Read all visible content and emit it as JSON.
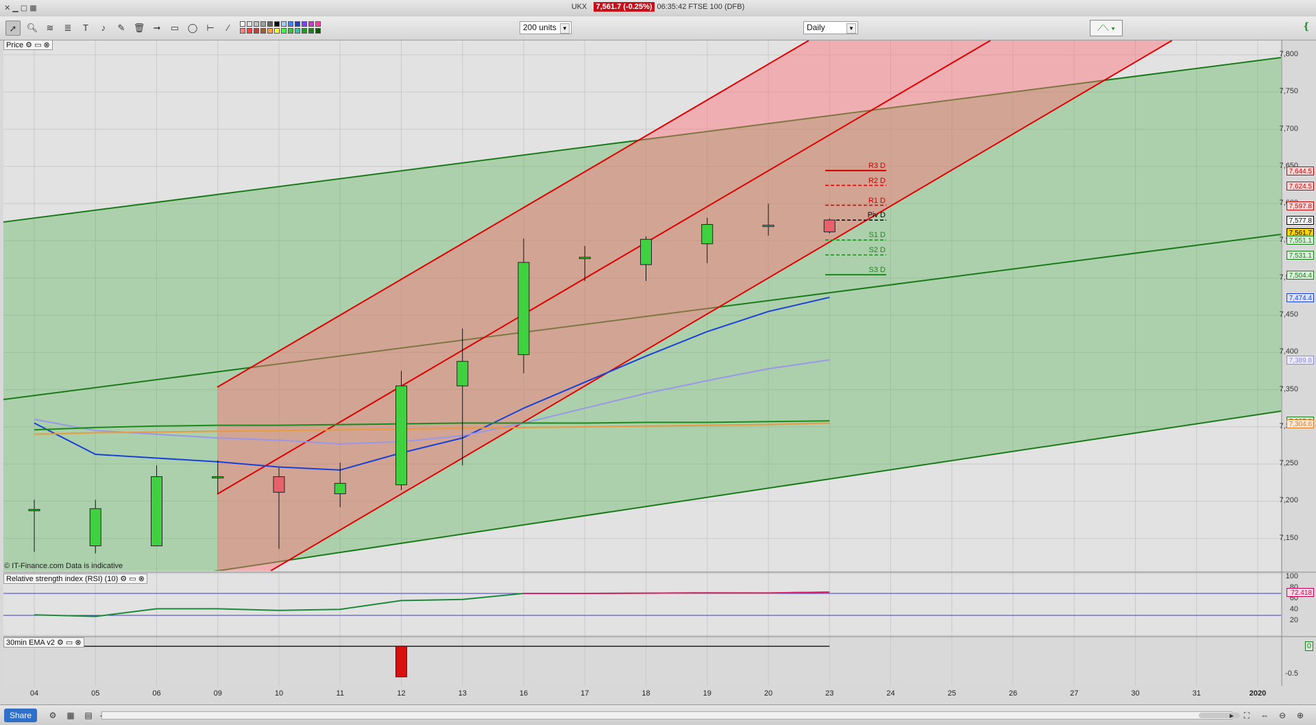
{
  "window": {
    "symbol": "UKX",
    "price_badge": "7,561.7 (-0.25%)",
    "status_line": "06:35:42 FTSE 100 (DFB)"
  },
  "toolbar": {
    "units_select": "200 units",
    "interval_select": "Daily"
  },
  "panels": {
    "price_label": "Price",
    "rsi_label": "Relative strength index (RSI) (10)",
    "ema_label": "30min EMA v2",
    "copyright": "© IT-Finance.com  Data is indicative"
  },
  "price_axis": {
    "ticks": [
      "7,800",
      "7,750",
      "7,700",
      "7,650",
      "7,600",
      "7,550",
      "7,500",
      "7,450",
      "7,400",
      "7,350",
      "7,300",
      "7,250",
      "7,200",
      "7,150"
    ],
    "tags": [
      {
        "text": "7,644.5",
        "color": "#cc0000",
        "bg": "#ffd9d9"
      },
      {
        "text": "7,624.5",
        "color": "#cc0000",
        "bg": "#ffd9d9"
      },
      {
        "text": "7,597.8",
        "color": "#cc0000",
        "bg": "#ffd9d9"
      },
      {
        "text": "7,577.8",
        "color": "#000000",
        "bg": "#ffffff"
      },
      {
        "text": "7,561.7",
        "color": "#000000",
        "bg": "#ffd400"
      },
      {
        "text": "7,551.1",
        "color": "#1a7a1a",
        "bg": "#d9f2d9"
      },
      {
        "text": "7,531.1",
        "color": "#1a7a1a",
        "bg": "#d9f2d9"
      },
      {
        "text": "7,504.4",
        "color": "#1a7a1a",
        "bg": "#d9f2d9"
      },
      {
        "text": "7,474.4",
        "color": "#1a3fd6",
        "bg": "#dde4ff"
      },
      {
        "text": "7,389.8",
        "color": "#8a86e0",
        "bg": "#ecebff"
      },
      {
        "text": "7,307.8",
        "color": "#1a7a1a",
        "bg": "#d9f2d9"
      },
      {
        "text": "7,304.6",
        "color": "#e07a20",
        "bg": "#ffe8d4"
      }
    ]
  },
  "pivots": [
    {
      "label": "R3 D",
      "color": "#cc0000"
    },
    {
      "label": "R2 D",
      "color": "#cc0000"
    },
    {
      "label": "R1 D",
      "color": "#cc0000"
    },
    {
      "label": "Piv D",
      "color": "#000000"
    },
    {
      "label": "S1 D",
      "color": "#1a8a1a"
    },
    {
      "label": "S2 D",
      "color": "#1a8a1a"
    },
    {
      "label": "S3 D",
      "color": "#1a8a1a"
    }
  ],
  "rsi_axis": {
    "ticks": [
      "100",
      "80",
      "60",
      "40",
      "20"
    ],
    "value_tag": "72.418"
  },
  "ema_axis": {
    "ticks": [
      "0",
      "-0.5"
    ]
  },
  "dates": [
    "04",
    "05",
    "06",
    "09",
    "10",
    "11",
    "12",
    "13",
    "16",
    "17",
    "18",
    "19",
    "20",
    "23",
    "24",
    "25",
    "26",
    "27",
    "30",
    "31",
    "2020"
  ],
  "bottom": {
    "share_label": "Share"
  },
  "chart_data": {
    "type": "candlestick",
    "title": "",
    "x": [
      "04",
      "05",
      "06",
      "09",
      "10",
      "11",
      "12",
      "13",
      "16",
      "17",
      "18",
      "19",
      "20",
      "23"
    ],
    "ohlc": [
      {
        "date": "04",
        "open": 7188,
        "high": 7202,
        "low": 7132,
        "close": 7189
      },
      {
        "date": "05",
        "open": 7140,
        "high": 7202,
        "low": 7130,
        "close": 7190
      },
      {
        "date": "06",
        "open": 7140,
        "high": 7248,
        "low": 7140,
        "close": 7233
      },
      {
        "date": "09",
        "open": 7232,
        "high": 7255,
        "low": 7210,
        "close": 7233
      },
      {
        "date": "10",
        "open": 7233,
        "high": 7245,
        "low": 7136,
        "close": 7212
      },
      {
        "date": "11",
        "open": 7210,
        "high": 7252,
        "low": 7192,
        "close": 7224
      },
      {
        "date": "12",
        "open": 7222,
        "high": 7375,
        "low": 7215,
        "close": 7355
      },
      {
        "date": "13",
        "open": 7355,
        "high": 7432,
        "low": 7248,
        "close": 7388
      },
      {
        "date": "16",
        "open": 7397,
        "high": 7553,
        "low": 7372,
        "close": 7521
      },
      {
        "date": "17",
        "open": 7526,
        "high": 7543,
        "low": 7496,
        "close": 7528
      },
      {
        "date": "18",
        "open": 7518,
        "high": 7556,
        "low": 7496,
        "close": 7552
      },
      {
        "date": "19",
        "open": 7546,
        "high": 7581,
        "low": 7520,
        "close": 7572
      },
      {
        "date": "20",
        "open": 7570,
        "high": 7600,
        "low": 7557,
        "close": 7571
      },
      {
        "date": "23",
        "open": 7578,
        "high": 7580,
        "low": 7560,
        "close": 7562
      }
    ],
    "ylim": [
      7120,
      7800
    ],
    "moving_averages": [
      {
        "color": "#1a3fd6",
        "values": [
          7305,
          7263,
          7258,
          7253,
          7246,
          7242,
          7265,
          7285,
          7325,
          7360,
          7395,
          7428,
          7455,
          7474
        ]
      },
      {
        "color": "#9a96e8",
        "values": [
          7310,
          7295,
          7290,
          7285,
          7282,
          7277,
          7280,
          7288,
          7305,
          7325,
          7345,
          7362,
          7378,
          7390
        ]
      },
      {
        "color": "#1a8a1a",
        "values": [
          7296,
          7299,
          7301,
          7302,
          7302,
          7303,
          7304,
          7305,
          7305,
          7305,
          7306,
          7306,
          7307,
          7308
        ]
      },
      {
        "color": "#e89a40",
        "values": [
          7290,
          7292,
          7293,
          7294,
          7295,
          7296,
          7297,
          7298,
          7299,
          7300,
          7301,
          7302,
          7303,
          7305
        ]
      }
    ],
    "pivots": {
      "R3": 7644.5,
      "R2": 7624.5,
      "R1": 7597.8,
      "Piv": 7577.8,
      "S1": 7551.1,
      "S2": 7531.1,
      "S3": 7504.4
    },
    "rsi": {
      "values": [
        31,
        28,
        42,
        42,
        39,
        41,
        57,
        59,
        70,
        70,
        70.5,
        71,
        70.8,
        72.4
      ],
      "ylim": [
        0,
        100
      ],
      "levels": [
        70,
        30
      ]
    },
    "ema_v2": {
      "bars": [
        {
          "date": "12",
          "value": -0.55
        }
      ],
      "ylim": [
        -0.7,
        0.1
      ]
    }
  }
}
